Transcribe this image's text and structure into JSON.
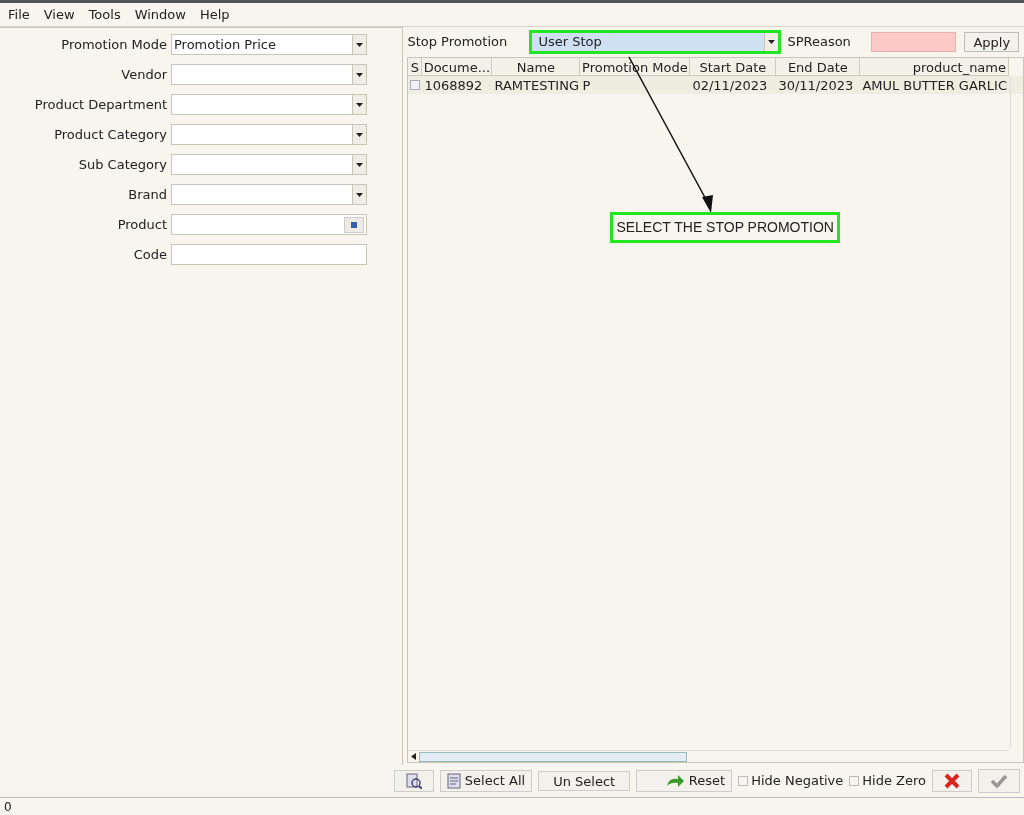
{
  "menu": [
    "File",
    "View",
    "Tools",
    "Window",
    "Help"
  ],
  "filters": [
    {
      "label": "Promotion Mode",
      "kind": "dropdown",
      "value": "Promotion Price"
    },
    {
      "label": "Vendor",
      "kind": "dropdown"
    },
    {
      "label": "Product Department",
      "kind": "dropdown"
    },
    {
      "label": "Product Category",
      "kind": "dropdown"
    },
    {
      "label": "Sub Category",
      "kind": "dropdown"
    },
    {
      "label": "Brand",
      "kind": "dropdown"
    },
    {
      "label": "Product",
      "kind": "lookup"
    },
    {
      "label": "Code",
      "kind": "text"
    }
  ],
  "stop_promotion": {
    "label": "Stop Promotion",
    "value": "User Stop",
    "reason_label": "SPReason",
    "apply": "Apply"
  },
  "table": {
    "select_column": "S",
    "columns": [
      "Docume...",
      "Name",
      "Promotion Mode",
      "Start Date",
      "End Date",
      "product_name"
    ],
    "rows": [
      {
        "checked": false,
        "cells": [
          "1068892",
          "RAMTESTING",
          "P",
          "02/11/2023",
          "30/11/2023",
          "AMUL BUTTER GARLIC"
        ]
      }
    ]
  },
  "annotation": "SELECT THE STOP PROMOTION",
  "toolbar": {
    "select_all": "Select All",
    "unselect": "Un Select",
    "reset": "Reset",
    "checks": [
      {
        "label": "Hide Negative",
        "checked": false
      },
      {
        "label": "Hide Zero",
        "checked": false
      }
    ]
  },
  "status_bar": "0"
}
